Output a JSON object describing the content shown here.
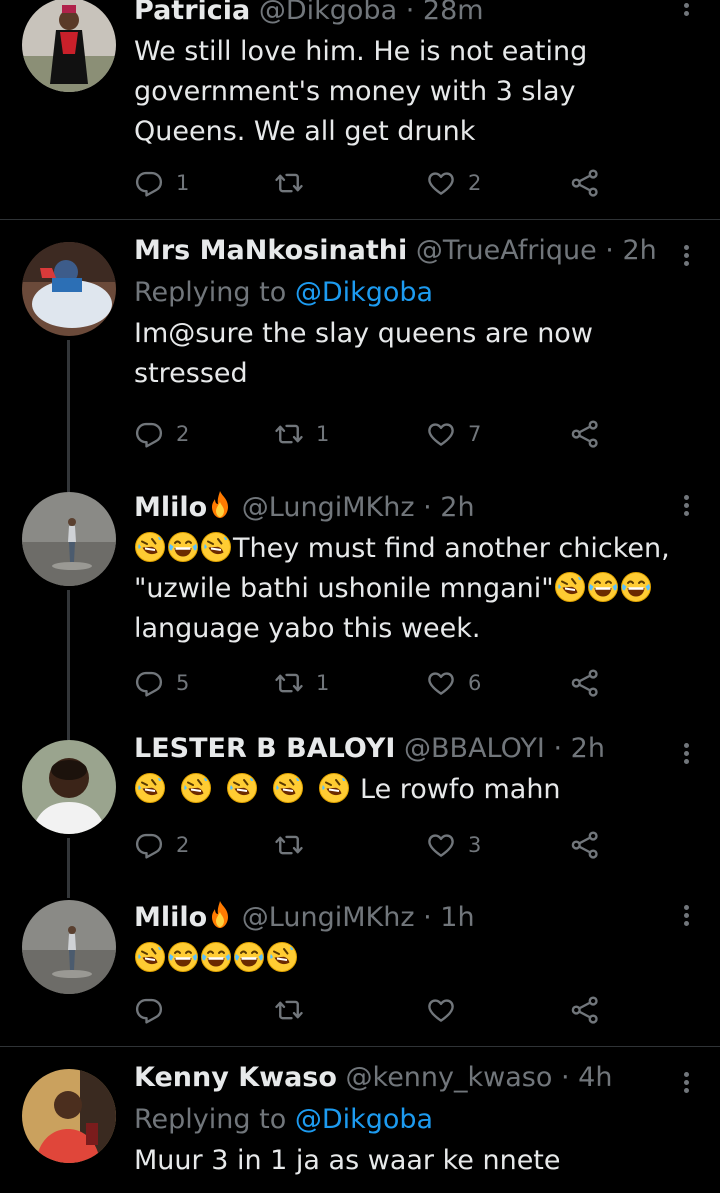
{
  "tweets": [
    {
      "name": "Patricia",
      "handle": "@Dikgoba",
      "time": "28m",
      "replying_to": "",
      "text": "We still love him. He is not eating government's money with 3 slay Queens. We all get drunk",
      "replies": "1",
      "retweets": "",
      "likes": "2"
    },
    {
      "name": "Mrs MaNkosinathi",
      "handle": "@TrueAfrique",
      "time": "2h",
      "replying_label": "Replying to",
      "replying_to": "@Dikgoba",
      "text": "Im@sure the slay queens are now stressed",
      "replies": "2",
      "retweets": "1",
      "likes": "7"
    },
    {
      "name": "Mlilo",
      "handle": "@LungiMKhz",
      "time": "2h",
      "replying_to": "",
      "text_pre_emoji": "🤣😂🤣",
      "text": "They must find another chicken, \"uzwile bathi ushonile mngani\"",
      "text_post_emoji": "🤣😂😂",
      "text_tail": "language yabo this week.",
      "replies": "5",
      "retweets": "1",
      "likes": "6"
    },
    {
      "name": "LESTER B  BALOYI",
      "handle": "@BBALOYI",
      "time": "2h",
      "replying_to": "",
      "text_emoji": "🤣 🤣 🤣 🤣 🤣",
      "text": "Le rowfo mahn",
      "replies": "2",
      "retweets": "",
      "likes": "3"
    },
    {
      "name": "Mlilo",
      "handle": "@LungiMKhz",
      "time": "1h",
      "replying_to": "",
      "text_emoji": "🤣😂😂😂🤣",
      "replies": "",
      "retweets": "",
      "likes": ""
    },
    {
      "name": "Kenny Kwaso",
      "handle": "@kenny_kwaso",
      "time": "4h",
      "replying_label": "Replying to",
      "replying_to": "@Dikgoba",
      "text": "Muur 3 in 1 ja as waar ke nnete"
    }
  ],
  "icons": {
    "reply": "reply-icon",
    "retweet": "retweet-icon",
    "like": "heart-icon",
    "share": "share-icon",
    "more": "more-icon",
    "fire": "fire-emoji"
  },
  "colors": {
    "background": "#000000",
    "text": "#e7e9ea",
    "muted": "#71767b",
    "link": "#1d9bf0",
    "divider": "#2f3336"
  }
}
